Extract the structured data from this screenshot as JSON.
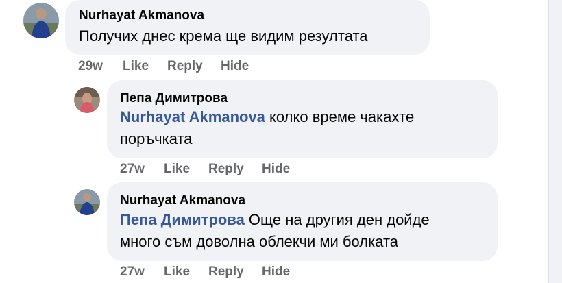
{
  "comments": [
    {
      "author": "Nurhayat Akmanova",
      "mention": "",
      "line1": "Получих днес крема ще видим резултата",
      "line2": "",
      "time": "29w",
      "like": "Like",
      "reply": "Reply",
      "hide": "Hide"
    },
    {
      "author": "Пепа Димитрова",
      "mention": "Nurhayat Akmanova",
      "line1": " колко време чакахте",
      "line2": "поръчката",
      "time": "27w",
      "like": "Like",
      "reply": "Reply",
      "hide": "Hide"
    },
    {
      "author": "Nurhayat Akmanova",
      "mention": "Пепа Димитрова",
      "line1": " Още на другия ден дойде",
      "line2": "много съм доволна облекчи ми болката",
      "time": "27w",
      "like": "Like",
      "reply": "Reply",
      "hide": "Hide"
    }
  ],
  "colors": {
    "bubble": "#f0f2f5",
    "mention": "#385898",
    "meta": "#65676b"
  }
}
